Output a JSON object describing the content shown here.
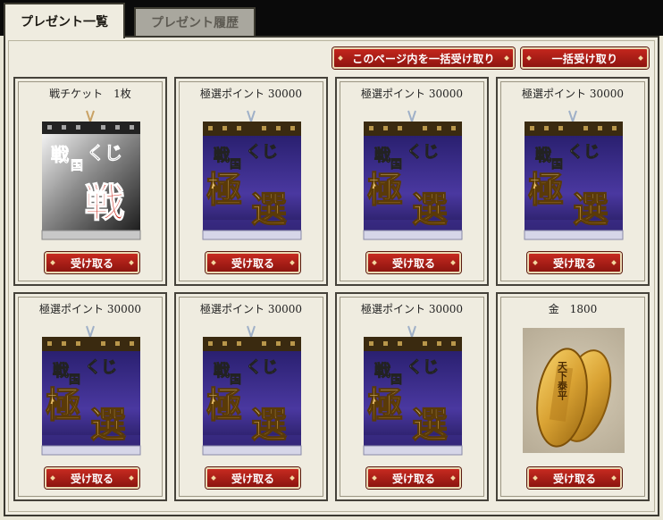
{
  "tabs": [
    {
      "label": "プレゼント一覧",
      "active": true
    },
    {
      "label": "プレゼント履歴",
      "active": false
    }
  ],
  "header_buttons": {
    "receive_page": "このページ内を一括受け取り",
    "receive_all": "一括受け取り"
  },
  "items": [
    {
      "label": "戦チケット　1枚",
      "type": "ticket",
      "icon": "sengoku-kuji-sen-ticket-icon",
      "button": "受け取る",
      "ticket_text": [
        "戦",
        "国",
        "くじ",
        "戦"
      ]
    },
    {
      "label": "極選ポイント 30000",
      "type": "gokusen",
      "icon": "sengoku-kuji-gokusen-ticket-icon",
      "button": "受け取る",
      "ticket_text": [
        "戦",
        "国",
        "くじ",
        "極",
        "選"
      ]
    },
    {
      "label": "極選ポイント 30000",
      "type": "gokusen",
      "icon": "sengoku-kuji-gokusen-ticket-icon",
      "button": "受け取る",
      "ticket_text": [
        "戦",
        "国",
        "くじ",
        "極",
        "選"
      ]
    },
    {
      "label": "極選ポイント 30000",
      "type": "gokusen",
      "icon": "sengoku-kuji-gokusen-ticket-icon",
      "button": "受け取る",
      "ticket_text": [
        "戦",
        "国",
        "くじ",
        "極",
        "選"
      ]
    },
    {
      "label": "極選ポイント 30000",
      "type": "gokusen",
      "icon": "sengoku-kuji-gokusen-ticket-icon",
      "button": "受け取る",
      "ticket_text": [
        "戦",
        "国",
        "くじ",
        "極",
        "選"
      ]
    },
    {
      "label": "極選ポイント 30000",
      "type": "gokusen",
      "icon": "sengoku-kuji-gokusen-ticket-icon",
      "button": "受け取る",
      "ticket_text": [
        "戦",
        "国",
        "くじ",
        "極",
        "選"
      ]
    },
    {
      "label": "極選ポイント 30000",
      "type": "gokusen",
      "icon": "sengoku-kuji-gokusen-ticket-icon",
      "button": "受け取る",
      "ticket_text": [
        "戦",
        "国",
        "くじ",
        "極",
        "選"
      ]
    },
    {
      "label": "金　1800",
      "type": "gold",
      "icon": "gold-koban-coins-icon",
      "button": "受け取る",
      "coin_text": "天下泰平"
    }
  ],
  "colors": {
    "button_red": "#b01f17",
    "ticket_purple": "#3e2e86",
    "gold": "#d9a233"
  }
}
